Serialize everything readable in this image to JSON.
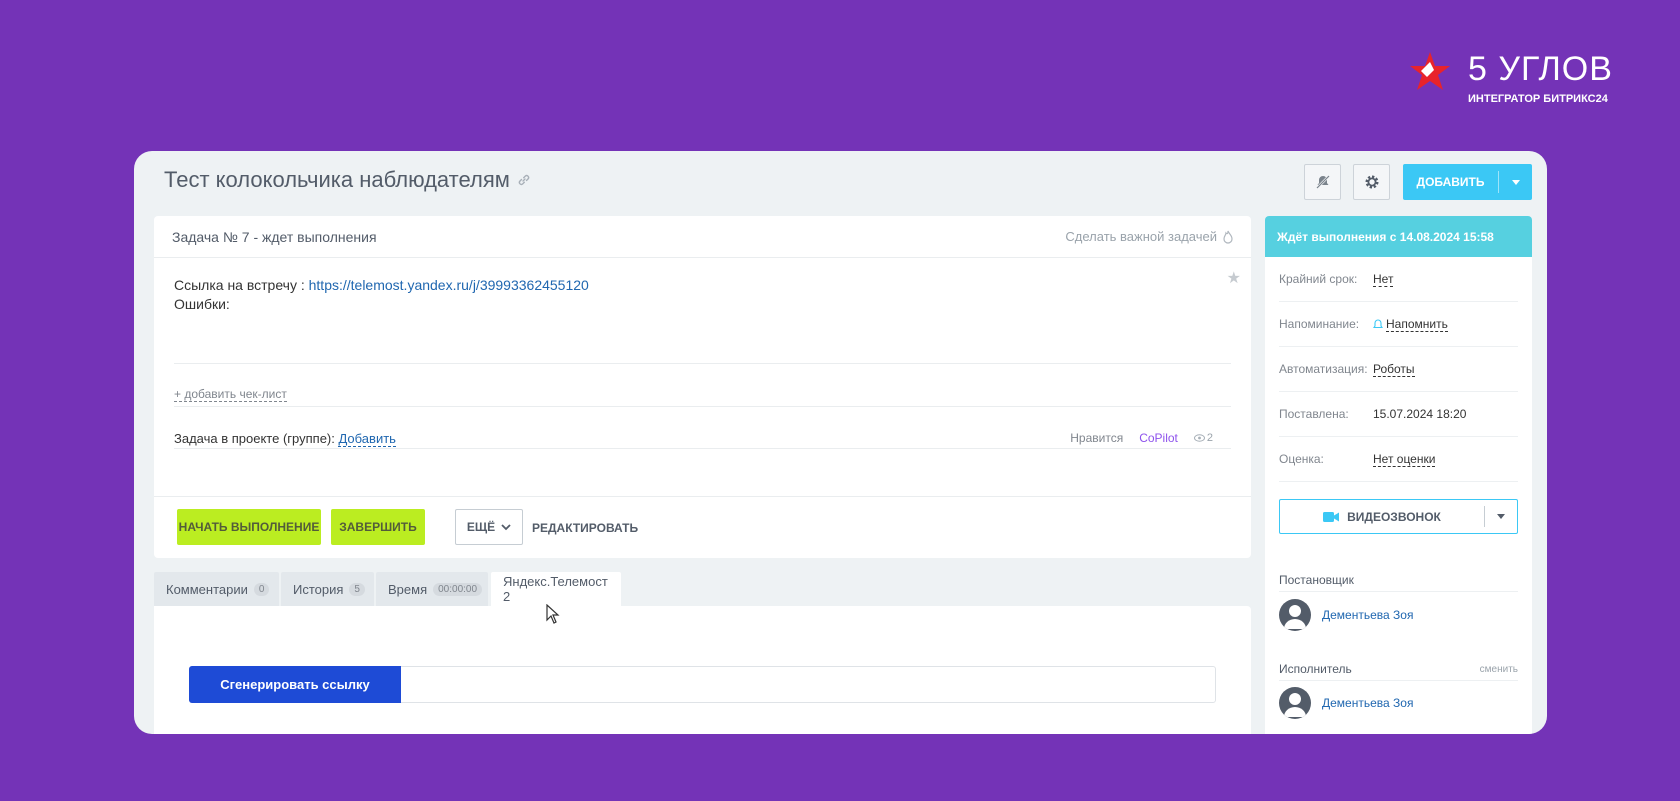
{
  "brand": {
    "name": "5 УГЛОВ",
    "subtitle": "ИНТЕГРАТОР БИТРИКС24"
  },
  "task": {
    "title": "Тест колокольчика наблюдателям",
    "header": "Задача № 7 - ждет выполнения",
    "make_important": "Сделать важной задачей",
    "description": {
      "link_label": "Ссылка на встречу : ",
      "link_url": "https://telemost.yandex.ru/j/39993362455120",
      "errors_label": "Ошибки:"
    },
    "add_checklist": "+ добавить чек-лист",
    "project_label": "Задача в проекте (группе): ",
    "project_add": "Добавить",
    "likes_label": "Нравится",
    "copilot_label": "CoPilot",
    "views": "2"
  },
  "toolbar": {
    "add_label": "ДОБАВИТЬ"
  },
  "actions": {
    "start": "НАЧАТЬ ВЫПОЛНЕНИЕ",
    "finish": "ЗАВЕРШИТЬ",
    "more": "ЕЩЁ",
    "edit": "РЕДАКТИРОВАТЬ"
  },
  "tabs": [
    {
      "label": "Комментарии",
      "count": "0"
    },
    {
      "label": "История",
      "count": "5"
    },
    {
      "label": "Время",
      "count": "00:00:00"
    },
    {
      "label": "Яндекс.Телемост 2"
    }
  ],
  "telemost": {
    "generate_label": "Сгенерировать ссылку"
  },
  "sidebar": {
    "status": "Ждёт выполнения с 14.08.2024 15:58",
    "fields": [
      {
        "key": "Крайний срок:",
        "value": "Нет"
      },
      {
        "key": "Напоминание:",
        "value": "Напомнить"
      },
      {
        "key": "Автоматизация:",
        "value": "Роботы"
      },
      {
        "key": "Поставлена:",
        "value": "15.07.2024 18:20"
      },
      {
        "key": "Оценка:",
        "value": "Нет оценки"
      }
    ],
    "video_label": "ВИДЕОЗВОНОК",
    "creator_label": "Постановщик",
    "creator_name": "Дементьева Зоя",
    "assignee_label": "Исполнитель",
    "assignee_change": "сменить",
    "assignee_name": "Дементьева Зоя"
  },
  "colors": {
    "background": "#7433b7",
    "accent": "#3bc8f5",
    "status_bar": "#56d0e0",
    "green_button": "#bbed21",
    "generate_button": "#1e4bd6"
  },
  "icons": [
    "star-logo-icon",
    "link-icon",
    "bell-off-icon",
    "gear-icon",
    "chevron-down-icon",
    "flame-icon",
    "star-icon",
    "eye-icon",
    "bell-icon",
    "camera-icon",
    "user-avatar-icon",
    "mouse-cursor-icon"
  ]
}
